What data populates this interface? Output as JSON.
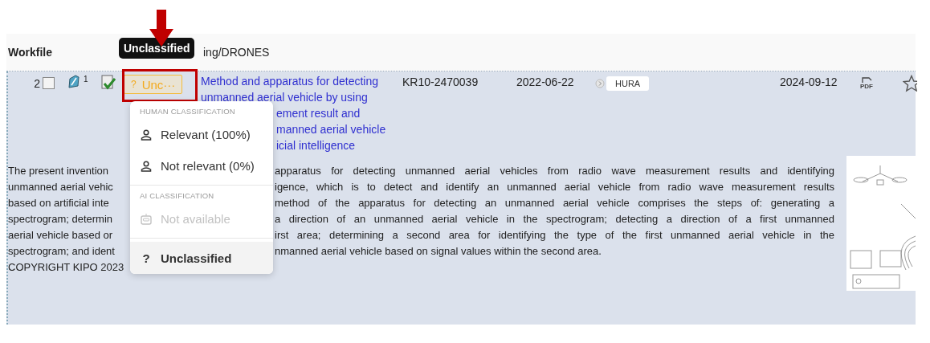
{
  "header": {
    "column_1": "Workfile",
    "column_2": "ing/DRONES"
  },
  "tooltip": "Unclassified",
  "row": {
    "index": "2",
    "checked": false,
    "note_count": "1",
    "classification": {
      "icon": "?",
      "label": "Unc···"
    },
    "title_lines": [
      {
        "text": "Method and apparatus for detecting",
        "partial": false
      },
      {
        "text": "unmanned aerial vehicle by using",
        "partial": false
      },
      {
        "text": "ement result and",
        "partial": true
      },
      {
        "text": "manned aerial vehicle",
        "partial": true
      },
      {
        "text": "icial intelligence",
        "partial": true
      }
    ],
    "publication_number": "KR10-2470039",
    "date_1": "2022-06-22",
    "tag": "HURA",
    "date_2": "2024-09-12",
    "pdf_label": "PDF",
    "starred": false,
    "abstract_lines": [
      {
        "left": "The present invention",
        "right": "apparatus for detecting unmanned aerial vehicles from radio wave measurement results and identifying"
      },
      {
        "left": "unmanned aerial vehic",
        "right": "igence, which is to detect and identify an unmanned aerial vehicle from radio wave measurement results"
      },
      {
        "left": "based on artificial inte",
        "right": "method of the apparatus for detecting an unmanned aerial vehicle comprises the steps of: generating a"
      },
      {
        "left": "spectrogram; determin",
        "right": "a direction of an unmanned aerial vehicle in the spectrogram; detecting a direction of a first unmanned"
      },
      {
        "left": "aerial vehicle based or",
        "right": "irst area; determining a second area for identifying the type of the first unmanned aerial vehicle in the"
      },
      {
        "left": "spectrogram; and ident",
        "right": "nmanned aerial vehicle based on signal values within the second area."
      },
      {
        "left": "COPYRIGHT KIPO 2023"
      }
    ]
  },
  "menu": {
    "sections": [
      {
        "heading": "HUMAN CLASSIFICATION",
        "items": [
          {
            "kind": "person",
            "label": "Relevant (100%)",
            "disabled": false,
            "selected": false
          },
          {
            "kind": "person",
            "label": "Not relevant (0%)",
            "disabled": false,
            "selected": false
          }
        ]
      },
      {
        "heading": "AI CLASSIFICATION",
        "items": [
          {
            "kind": "robot",
            "label": "Not available",
            "disabled": true,
            "selected": false
          }
        ]
      },
      {
        "items": [
          {
            "kind": "glyph",
            "icon": "?",
            "label": "Unclassified",
            "disabled": false,
            "selected": true
          }
        ]
      }
    ]
  }
}
